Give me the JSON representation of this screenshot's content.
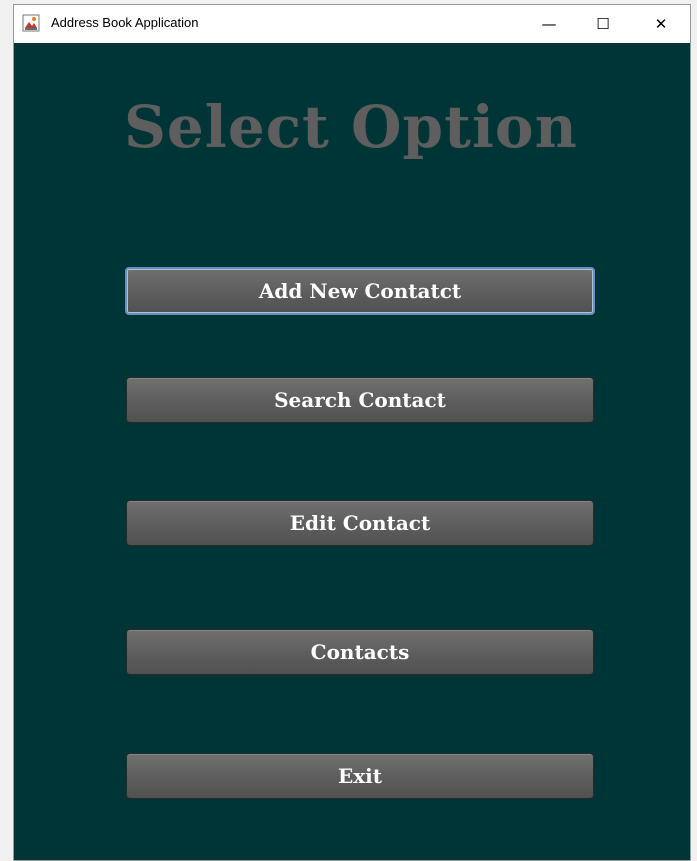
{
  "window": {
    "title": "Address Book Application",
    "icon": "java-app-icon",
    "controls": {
      "minimize": "—",
      "maximize": "☐",
      "close": "✕"
    }
  },
  "main": {
    "heading": "Select Option",
    "buttons": [
      {
        "label": "Add New Contatct"
      },
      {
        "label": "Search Contact"
      },
      {
        "label": "Edit Contact"
      },
      {
        "label": "Contacts"
      },
      {
        "label": "Exit"
      }
    ]
  },
  "colors": {
    "background": "#003537",
    "heading": "#5e5e5e",
    "button": "#5d5d5d",
    "button_text": "#ffffff",
    "focus_border": "#6a8fb8"
  }
}
